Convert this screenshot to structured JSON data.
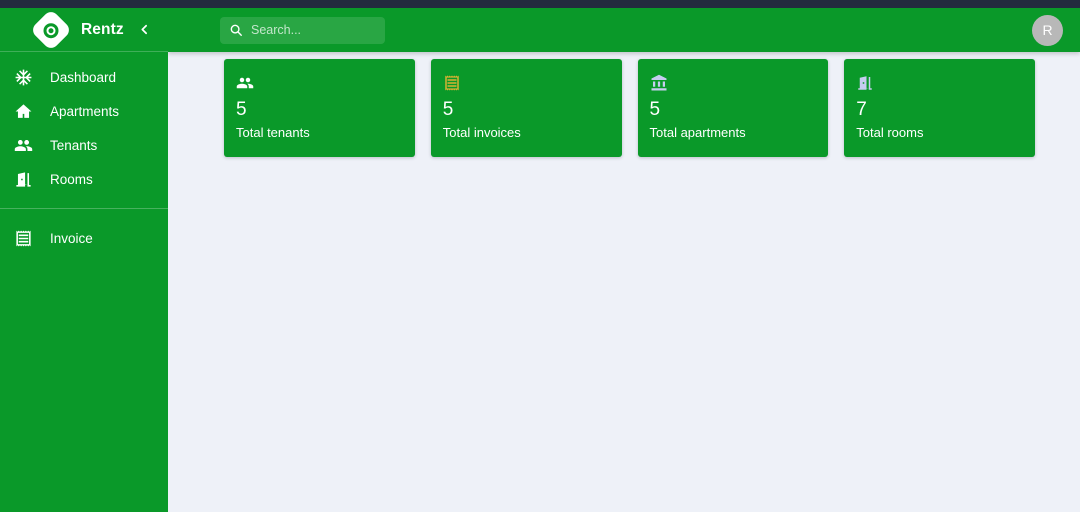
{
  "app": {
    "brand_name": "Rentz",
    "logo_icon": "target-logo-icon",
    "collapse_icon": "chevron-left-icon",
    "accent_color": "#0a9929",
    "topbar_color": "#232b3e",
    "content_bg_color": "#eef1f8"
  },
  "sidebar": {
    "items": [
      {
        "label": "Dashboard",
        "icon": "snowflake-icon"
      },
      {
        "label": "Apartments",
        "icon": "home-icon"
      },
      {
        "label": "Tenants",
        "icon": "people-icon"
      },
      {
        "label": "Rooms",
        "icon": "door-icon"
      },
      {
        "label": "Invoice",
        "icon": "receipt-icon"
      }
    ]
  },
  "header": {
    "search": {
      "icon": "search-icon",
      "value": "",
      "placeholder": "Search..."
    },
    "avatar": {
      "initial": "R",
      "color": "#b8b8b8"
    }
  },
  "main": {
    "cards": [
      {
        "value": "5",
        "label": "Total tenants",
        "icon": "people-icon",
        "icon_color": "#ffffff"
      },
      {
        "value": "5",
        "label": "Total invoices",
        "icon": "receipt-icon",
        "icon_color": "#d8b232"
      },
      {
        "value": "5",
        "label": "Total apartments",
        "icon": "bank-icon",
        "icon_color": "#c6cdf0"
      },
      {
        "value": "7",
        "label": "Total rooms",
        "icon": "door-icon",
        "icon_color": "#c6cdf0"
      }
    ]
  }
}
